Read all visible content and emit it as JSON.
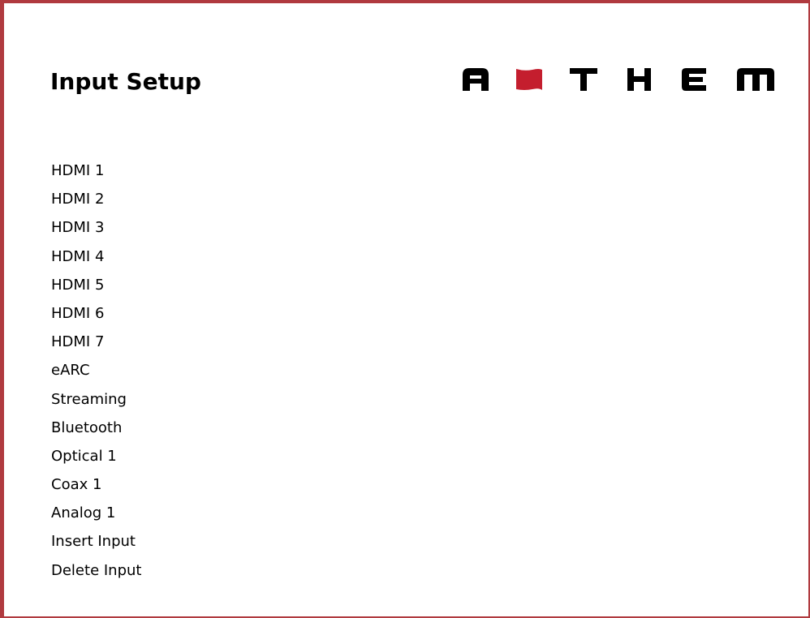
{
  "page": {
    "title": "Input Setup"
  },
  "brand": {
    "logo_text": "ANTHEM",
    "accent_color": "#b03a3f",
    "frame_color": "#b03a3f",
    "flag_color": "#c41e2e"
  },
  "menu": {
    "items": [
      {
        "label": "HDMI 1"
      },
      {
        "label": "HDMI 2"
      },
      {
        "label": "HDMI 3"
      },
      {
        "label": "HDMI 4"
      },
      {
        "label": "HDMI 5"
      },
      {
        "label": "HDMI 6"
      },
      {
        "label": "HDMI 7"
      },
      {
        "label": "eARC"
      },
      {
        "label": "Streaming"
      },
      {
        "label": "Bluetooth"
      },
      {
        "label": "Optical 1"
      },
      {
        "label": "Coax 1"
      },
      {
        "label": "Analog 1"
      },
      {
        "label": "Insert Input"
      },
      {
        "label": "Delete Input"
      }
    ]
  }
}
